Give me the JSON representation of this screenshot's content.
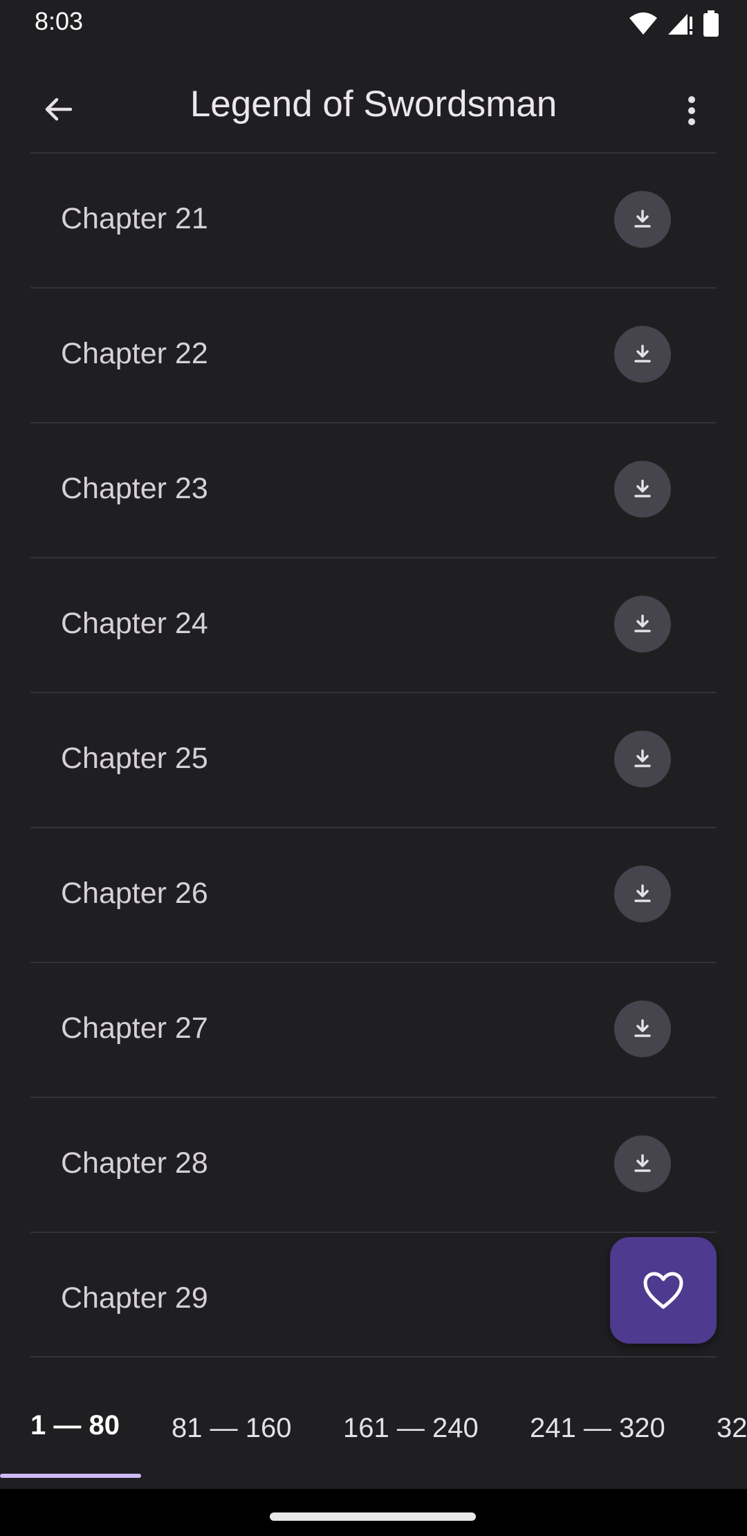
{
  "status_bar": {
    "time": "8:03",
    "icons": [
      "wifi-icon",
      "cellular-signal-icon",
      "battery-icon"
    ]
  },
  "app_bar": {
    "title": "Legend of Swordsman",
    "back_icon": "arrow-back-icon",
    "menu_icon": "more-vert-icon"
  },
  "chapters": [
    {
      "label": "Chapter 21"
    },
    {
      "label": "Chapter 22"
    },
    {
      "label": "Chapter 23"
    },
    {
      "label": "Chapter 24"
    },
    {
      "label": "Chapter 25"
    },
    {
      "label": "Chapter 26"
    },
    {
      "label": "Chapter 27"
    },
    {
      "label": "Chapter 28"
    },
    {
      "label": "Chapter 29"
    }
  ],
  "fab": {
    "icon": "heart-outline-icon"
  },
  "tabs": [
    {
      "label": "1 — 80",
      "active": true
    },
    {
      "label": "81 — 160",
      "active": false
    },
    {
      "label": "161 — 240",
      "active": false
    },
    {
      "label": "241 — 320",
      "active": false
    },
    {
      "label": "32",
      "active": false
    }
  ],
  "colors": {
    "background": "#1f1f22",
    "download_button": "#46444c",
    "fab": "#4e3a8e",
    "tab_indicator": "#cdb9f5"
  }
}
